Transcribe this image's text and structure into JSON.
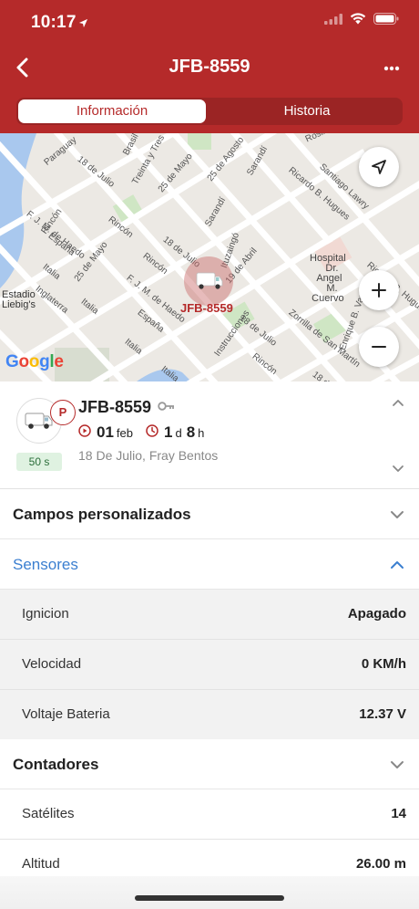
{
  "status_bar": {
    "time": "10:17"
  },
  "header": {
    "title": "JFB-8559"
  },
  "tabs": [
    {
      "label": "Información",
      "active": true
    },
    {
      "label": "Historia",
      "active": false
    }
  ],
  "map": {
    "provider_logo": "Google",
    "marker_label": "JFB-8559",
    "streets": [
      "Paraguay",
      "18 de Julio",
      "Brasil",
      "Treinta y Tres",
      "25 de Mayo",
      "25 de Agosto",
      "Sarandí",
      "Ricardo B. Hugues",
      "Santiago Lawry",
      "Rincón",
      "F. J. M. de Haedo",
      "España",
      "Italia",
      "Inglaterra",
      "Ituzaingó",
      "19 de Abril",
      "Instrucciones",
      "Zorrilla de San Martín",
      "Enrique B. Varela",
      "Ricardo B. Hugues",
      "Rosik Bichkov"
    ],
    "places": [
      "Estadio Liebig's",
      "Hospital Dr. Angel M. Cuervo"
    ],
    "buttons": [
      "locate",
      "zoom-in",
      "zoom-out"
    ]
  },
  "vehicle": {
    "plate": "JFB-8559",
    "status_badge": "P",
    "age": "50 s",
    "date_day": "01",
    "date_month": "feb",
    "duration_days": "1",
    "duration_days_unit": "d",
    "duration_hours": "8",
    "duration_hours_unit": "h",
    "address": "18 De Julio, Fray Bentos"
  },
  "sections": {
    "custom_fields": {
      "label": "Campos personalizados",
      "expanded": false
    },
    "sensors": {
      "label": "Sensores",
      "expanded": true,
      "rows": [
        {
          "label": "Ignicion",
          "value": "Apagado"
        },
        {
          "label": "Velocidad",
          "value": "0 KM/h"
        },
        {
          "label": "Voltaje Bateria",
          "value": "12.37 V"
        }
      ]
    },
    "counters": {
      "label": "Contadores",
      "expanded": true,
      "rows": [
        {
          "label": "Satélites",
          "value": "14"
        },
        {
          "label": "Altitud",
          "value": "26.00 m"
        }
      ]
    }
  },
  "colors": {
    "brand": "#b52a2a",
    "link": "#3b7fd0",
    "badge_green_bg": "#dff2e1"
  }
}
